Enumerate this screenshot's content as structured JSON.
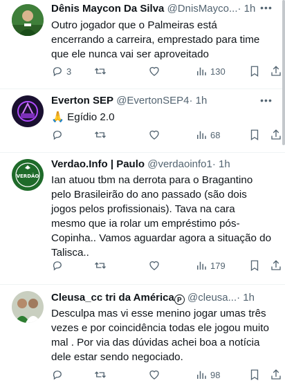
{
  "tweets": [
    {
      "name": "Dênis Maycon Da Silva",
      "handle": "@DnisMayco...",
      "time": "· 1h",
      "text": "Outro jogador que o Palmeiras está\nencerrando a carreira, emprestado para time\nque ele nunca vai ser aproveitado",
      "replies": "3",
      "retweets": "",
      "likes": "",
      "views": "130",
      "avatar_color": "#2e7d32"
    },
    {
      "name": "Everton SEP",
      "handle": "@EvertonSEP4",
      "time": "· 1h",
      "text": "🙏 Egídio 2.0",
      "replies": "",
      "retweets": "",
      "likes": "",
      "views": "68",
      "avatar_color": "#4a148c"
    },
    {
      "name": "Verdao.Info | Paulo",
      "handle": "@verdaoinfo1",
      "time": "· 1h",
      "text": "Ian atuou tbm na derrota para o Bragantino\npelo Brasileirão do ano passado (são dois\njogos pelos profissionais). Tava na cara\nmesmo que ia rolar um empréstimo pós-\nCopinha.. Vamos aguardar agora a situação do\nTalisca..",
      "replies": "",
      "retweets": "",
      "likes": "",
      "views": "179",
      "avatar_color": "#1b5e20",
      "avatar_text": "VERDÃO"
    },
    {
      "name": "Cleusa_cc tri da América",
      "name_mark": "P",
      "handle": "@cleusa...",
      "time": "· 1h",
      "text": "Desculpa mas vi esse menino jogar umas três\nvezes e por coincidência todas ele jogou muito\nmal . Por via das dúvidas achei boa a notícia\ndele estar sendo negociado.",
      "replies": "",
      "retweets": "",
      "likes": "",
      "views": "98",
      "avatar_color": "#8d9a7a"
    }
  ],
  "icons": {
    "reply": "reply-icon",
    "retweet": "retweet-icon",
    "like": "heart-icon",
    "views": "views-icon",
    "bookmark": "bookmark-icon",
    "share": "share-icon",
    "more": "more-icon"
  },
  "colors": {
    "text": "#0f1419",
    "muted": "#536471",
    "divider": "#eff3f4"
  }
}
